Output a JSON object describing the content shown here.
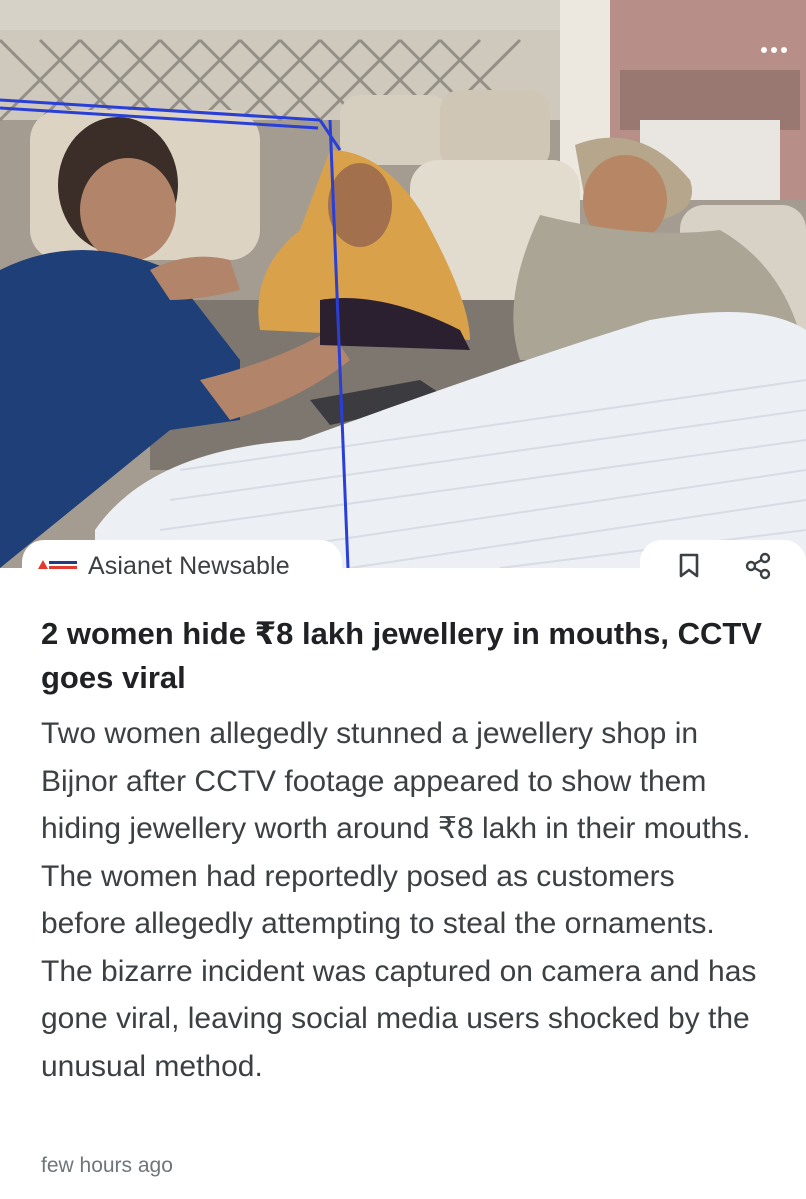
{
  "article": {
    "source": "Asianet Newsable",
    "headline": "2 women hide ₹8 lakh jewellery in mouths, CCTV goes viral",
    "summary": "Two women allegedly stunned a jewellery shop in Bijnor after CCTV footage appeared to show them hiding jewellery worth around ₹8 lakh in their mouths. The women had reportedly posed as customers before allegedly attempting to steal the ornaments. The bizarre incident was captured on camera and has gone viral, leaving social media users shocked by the unusual method.",
    "timestamp": "few hours ago"
  },
  "icons": {
    "more": "more-dots-icon",
    "bookmark": "bookmark-icon",
    "share": "share-icon",
    "source_logo": "asianet-logo-icon"
  },
  "colors": {
    "text_primary": "#202124",
    "text_body": "#3c4043",
    "text_muted": "#70757a",
    "overlay_line": "#2a3fd6"
  }
}
